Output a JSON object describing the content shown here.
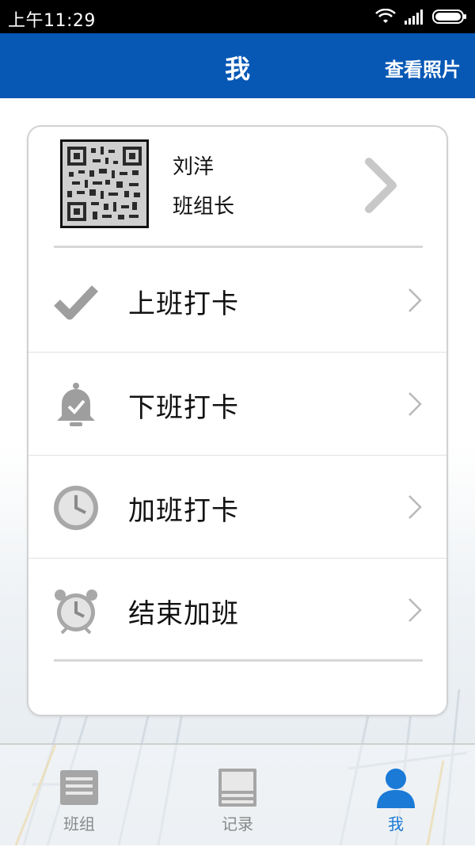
{
  "status_bar": {
    "time": "上午11:29"
  },
  "header": {
    "title": "我",
    "action_label": "查看照片"
  },
  "profile": {
    "name": "刘洋",
    "role": "班组长"
  },
  "menu": [
    {
      "label": "上班打卡",
      "icon": "checkmark-icon"
    },
    {
      "label": "下班打卡",
      "icon": "bell-check-icon"
    },
    {
      "label": "加班打卡",
      "icon": "clock-icon"
    },
    {
      "label": "结束加班",
      "icon": "alarm-clock-icon"
    }
  ],
  "tabs": [
    {
      "label": "班组",
      "icon": "team-list-icon",
      "active": false
    },
    {
      "label": "记录",
      "icon": "records-icon",
      "active": false
    },
    {
      "label": "我",
      "icon": "person-icon",
      "active": true
    }
  ],
  "colors": {
    "header_bg": "#0758b5",
    "active_tab": "#1a7ad6",
    "icon_gray": "#9e9e9e"
  }
}
